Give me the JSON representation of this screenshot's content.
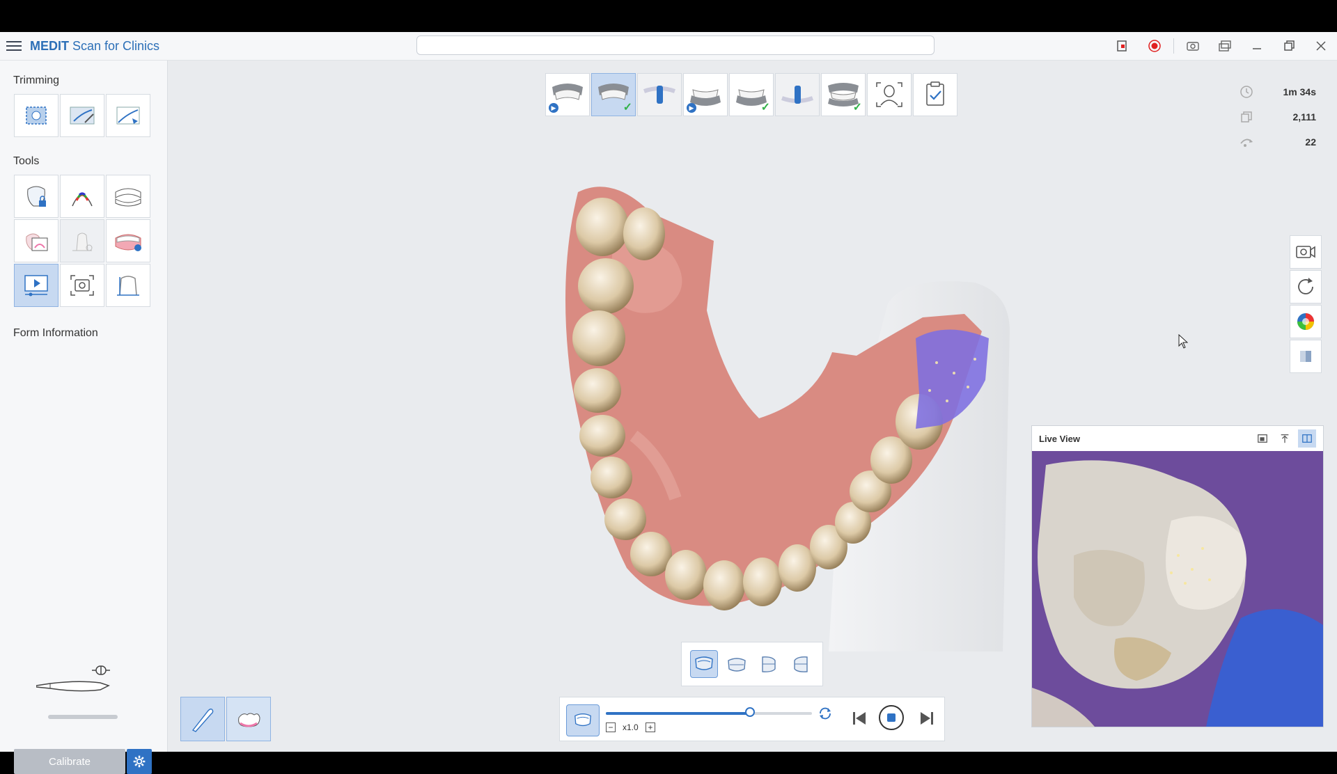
{
  "app": {
    "title_bold": "MEDIT",
    "title_rest": " Scan for Clinics"
  },
  "sidebar": {
    "trimming_title": "Trimming",
    "tools_title": "Tools",
    "form_title": "Form Information",
    "calibrate_label": "Calibrate",
    "trimming_items": [
      "select-area-icon",
      "trim-brush-icon",
      "trim-region-icon"
    ],
    "tool_items": [
      "lock-tooth-icon",
      "color-margin-icon",
      "arch-icon",
      "overlay-icon",
      "tooth-removed-icon",
      "gum-icon",
      "playback-icon",
      "snapshot-icon",
      "measure-icon"
    ]
  },
  "stepbar": {
    "steps": [
      "maxilla-scan",
      "maxilla-done",
      "abutment-upper",
      "mandible-scan",
      "mandible-done",
      "abutment-lower",
      "occlusion-done",
      "face-scan",
      "review"
    ]
  },
  "stats": {
    "time": "1m 34s",
    "frames": "2,111",
    "shots": "22"
  },
  "live_view": {
    "title": "Live View"
  },
  "playback": {
    "speed": "x1.0",
    "progress": 0.7
  },
  "colors": {
    "accent": "#2f72c4",
    "active_bg": "#c7d9f1",
    "check": "#33b24a",
    "record": "#e02020"
  }
}
